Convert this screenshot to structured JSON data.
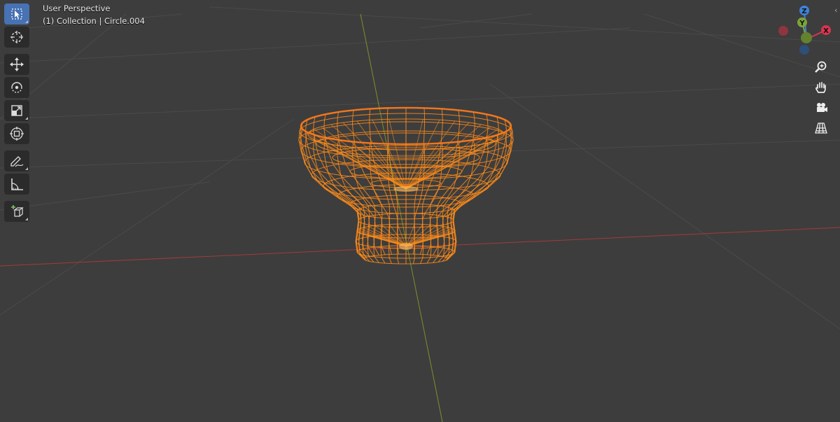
{
  "viewport": {
    "view_name": "User Perspective",
    "object_info": "(1) Collection | Circle.004",
    "colors": {
      "background": "#3d3d3d",
      "grid": "#4a4a4a",
      "x_axis": "#b03a3a",
      "y_axis": "#7f9a2a",
      "wireframe": "#ff8c1a",
      "wireframe_bright": "#ffc060"
    }
  },
  "toolbar": {
    "tools": [
      {
        "name": "select-box",
        "icon": "select-box-icon",
        "active": true
      },
      {
        "name": "cursor",
        "icon": "cursor-icon",
        "active": false
      },
      {
        "name": "move",
        "icon": "move-icon",
        "active": false
      },
      {
        "name": "rotate",
        "icon": "rotate-icon",
        "active": false
      },
      {
        "name": "scale",
        "icon": "scale-icon",
        "active": false
      },
      {
        "name": "transform",
        "icon": "transform-icon",
        "active": false
      },
      {
        "name": "annotate",
        "icon": "annotate-icon",
        "active": false
      },
      {
        "name": "measure",
        "icon": "measure-icon",
        "active": false
      },
      {
        "name": "add-cube",
        "icon": "add-cube-icon",
        "active": false
      }
    ]
  },
  "gizmo": {
    "z_label": "Z",
    "y_label": "Y",
    "x_label": "X",
    "colors": {
      "x": "#d9354f",
      "y": "#7ba33a",
      "z": "#3f82d6"
    }
  },
  "navigation": [
    {
      "name": "zoom",
      "icon": "zoom-icon"
    },
    {
      "name": "pan",
      "icon": "hand-icon"
    },
    {
      "name": "camera",
      "icon": "camera-icon"
    },
    {
      "name": "perspective",
      "icon": "grid-icon"
    }
  ],
  "edge_toggle": "‹"
}
